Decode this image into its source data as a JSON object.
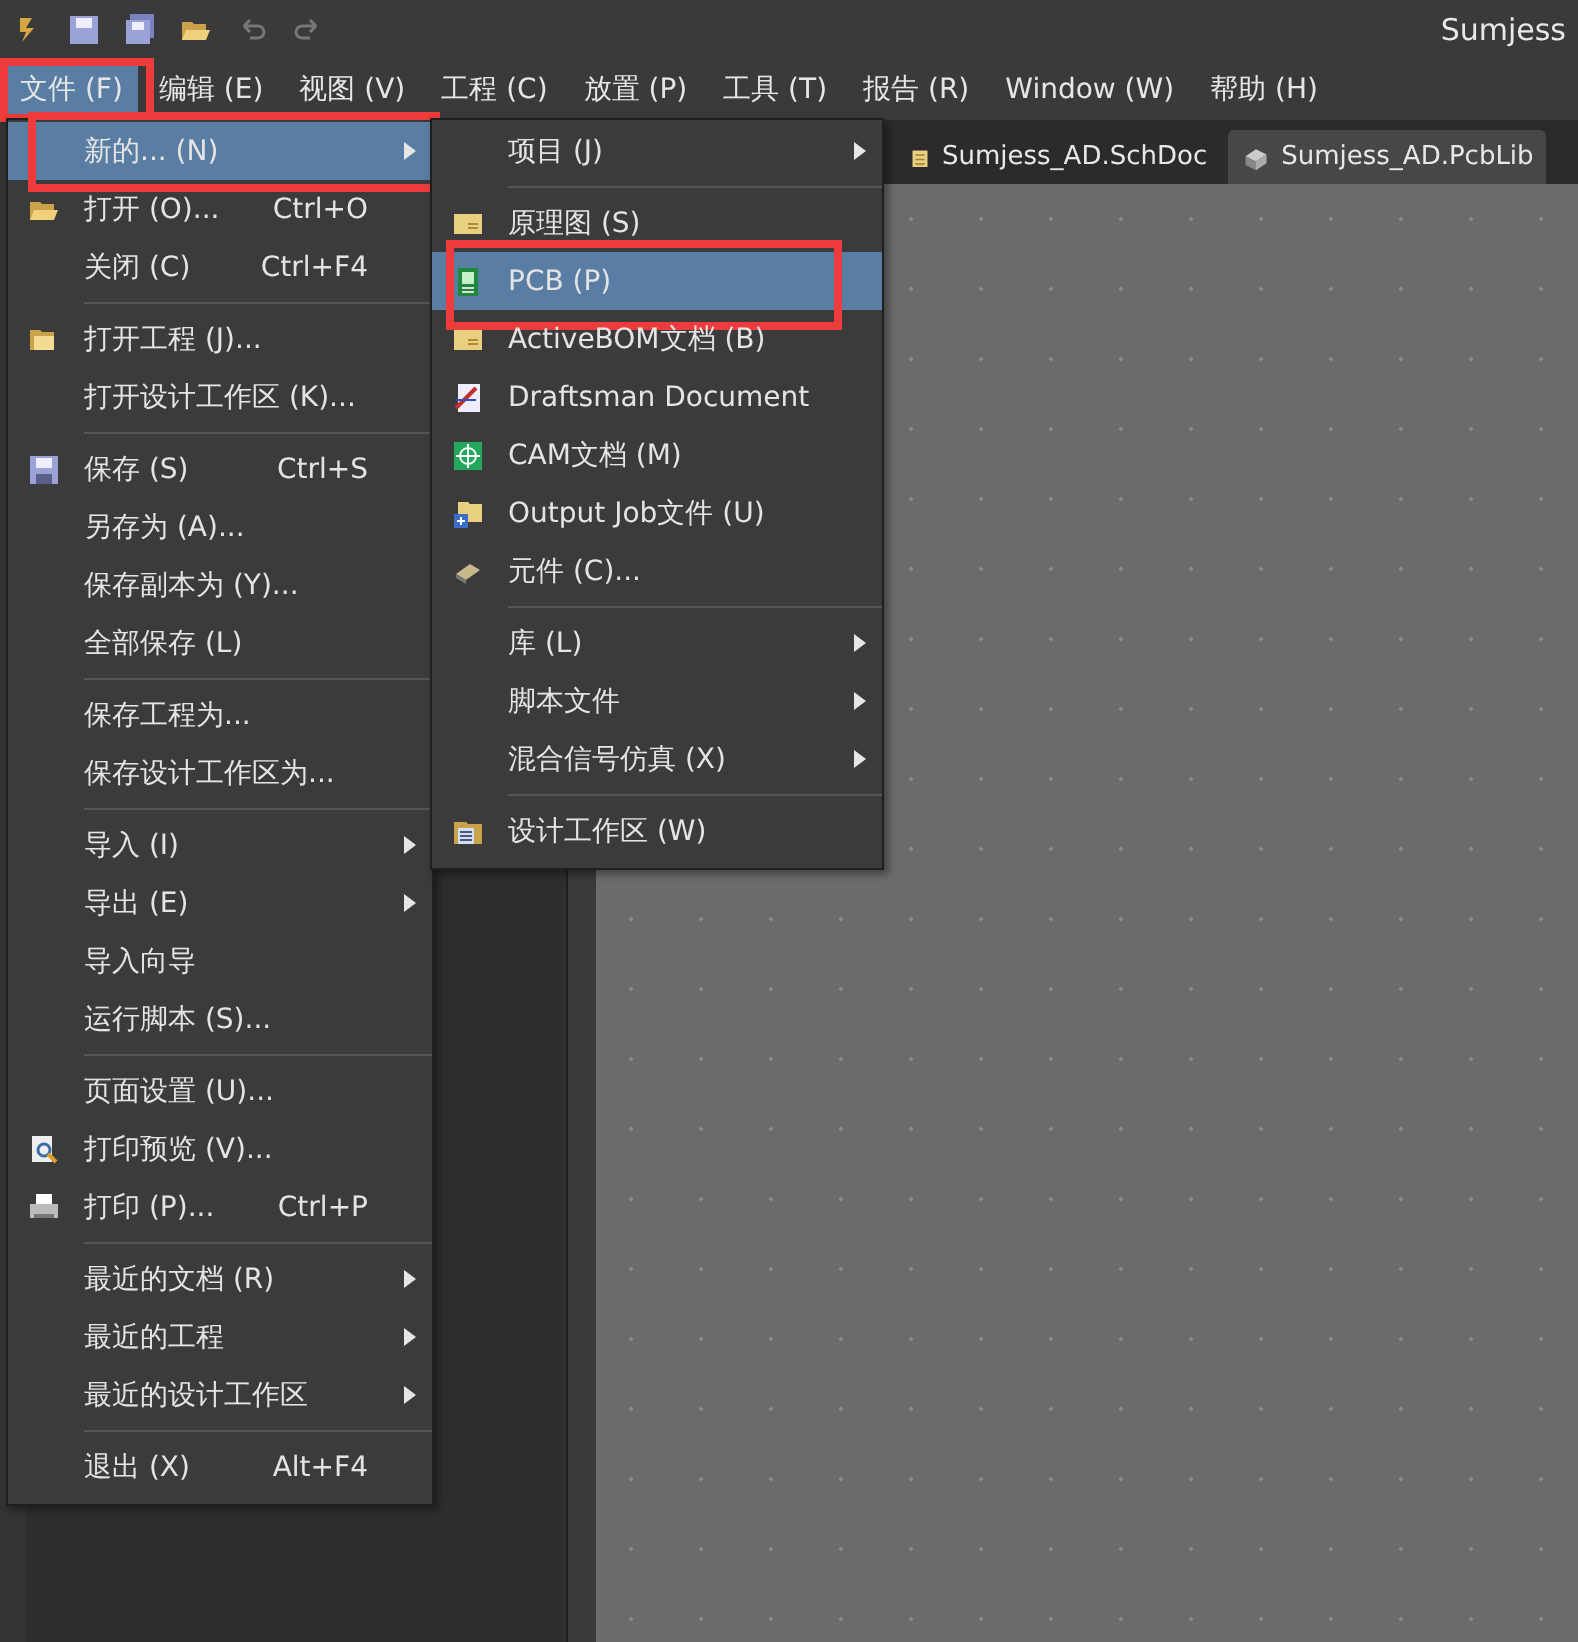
{
  "window": {
    "title": "Sumjess"
  },
  "menu_bar": [
    {
      "label": "文件 (F)",
      "selected": true,
      "highlighted": true
    },
    {
      "label": "编辑 (E)",
      "selected": false,
      "highlighted": false
    },
    {
      "label": "视图 (V)",
      "selected": false,
      "highlighted": false
    },
    {
      "label": "工程 (C)",
      "selected": false,
      "highlighted": false
    },
    {
      "label": "放置 (P)",
      "selected": false,
      "highlighted": false
    },
    {
      "label": "工具 (T)",
      "selected": false,
      "highlighted": false
    },
    {
      "label": "报告 (R)",
      "selected": false,
      "highlighted": false
    },
    {
      "label": "Window (W)",
      "selected": false,
      "highlighted": false
    },
    {
      "label": "帮助 (H)",
      "selected": false,
      "highlighted": false
    }
  ],
  "tabs": [
    {
      "label": "Sumjess_AD.SchDoc",
      "selected": false
    },
    {
      "label": "Sumjess_AD.PcbLib",
      "selected": true
    }
  ],
  "file_menu": [
    {
      "kind": "item",
      "label": "新的... (N)",
      "submenu": true,
      "selected": true,
      "highlighted": true
    },
    {
      "kind": "item",
      "label": "打开 (O)...",
      "shortcut": "Ctrl+O",
      "submenu": false,
      "selected": false,
      "highlighted": false
    },
    {
      "kind": "item",
      "label": "关闭 (C)",
      "shortcut": "Ctrl+F4",
      "submenu": false,
      "selected": false,
      "highlighted": false
    },
    {
      "kind": "separator"
    },
    {
      "kind": "item",
      "label": "打开工程 (J)...",
      "submenu": false,
      "selected": false,
      "highlighted": false
    },
    {
      "kind": "item",
      "label": "打开设计工作区 (K)...",
      "submenu": false,
      "selected": false,
      "highlighted": false
    },
    {
      "kind": "separator"
    },
    {
      "kind": "item",
      "label": "保存 (S)",
      "shortcut": "Ctrl+S",
      "submenu": false,
      "selected": false,
      "highlighted": false
    },
    {
      "kind": "item",
      "label": "另存为 (A)...",
      "submenu": false,
      "selected": false,
      "highlighted": false
    },
    {
      "kind": "item",
      "label": "保存副本为 (Y)...",
      "submenu": false,
      "selected": false,
      "highlighted": false
    },
    {
      "kind": "item",
      "label": "全部保存 (L)",
      "submenu": false,
      "selected": false,
      "highlighted": false
    },
    {
      "kind": "separator"
    },
    {
      "kind": "item",
      "label": "保存工程为...",
      "submenu": false,
      "selected": false,
      "highlighted": false
    },
    {
      "kind": "item",
      "label": "保存设计工作区为...",
      "submenu": false,
      "selected": false,
      "highlighted": false
    },
    {
      "kind": "separator"
    },
    {
      "kind": "item",
      "label": "导入 (I)",
      "submenu": true,
      "selected": false,
      "highlighted": false
    },
    {
      "kind": "item",
      "label": "导出 (E)",
      "submenu": true,
      "selected": false,
      "highlighted": false
    },
    {
      "kind": "item",
      "label": "导入向导",
      "submenu": false,
      "selected": false,
      "highlighted": false
    },
    {
      "kind": "item",
      "label": "运行脚本 (S)...",
      "submenu": false,
      "selected": false,
      "highlighted": false
    },
    {
      "kind": "separator"
    },
    {
      "kind": "item",
      "label": "页面设置 (U)...",
      "submenu": false,
      "selected": false,
      "highlighted": false
    },
    {
      "kind": "item",
      "label": "打印预览 (V)...",
      "submenu": false,
      "selected": false,
      "highlighted": false
    },
    {
      "kind": "item",
      "label": "打印 (P)...",
      "shortcut": "Ctrl+P",
      "submenu": false,
      "selected": false,
      "highlighted": false
    },
    {
      "kind": "separator"
    },
    {
      "kind": "item",
      "label": "最近的文档 (R)",
      "submenu": true,
      "selected": false,
      "highlighted": false
    },
    {
      "kind": "item",
      "label": "最近的工程",
      "submenu": true,
      "selected": false,
      "highlighted": false
    },
    {
      "kind": "item",
      "label": "最近的设计工作区",
      "submenu": true,
      "selected": false,
      "highlighted": false
    },
    {
      "kind": "separator"
    },
    {
      "kind": "item",
      "label": "退出 (X)",
      "shortcut": "Alt+F4",
      "submenu": false,
      "selected": false,
      "highlighted": false
    }
  ],
  "new_submenu": [
    {
      "kind": "item",
      "label": "项目 (J)",
      "submenu": true,
      "selected": false,
      "highlighted": false
    },
    {
      "kind": "separator"
    },
    {
      "kind": "item",
      "label": "原理图 (S)",
      "submenu": false,
      "selected": false,
      "highlighted": false
    },
    {
      "kind": "item",
      "label": "PCB (P)",
      "submenu": false,
      "selected": true,
      "highlighted": true
    },
    {
      "kind": "item",
      "label": "ActiveBOM文档 (B)",
      "submenu": false,
      "selected": false,
      "highlighted": false
    },
    {
      "kind": "item",
      "label": "Draftsman Document",
      "submenu": false,
      "selected": false,
      "highlighted": false
    },
    {
      "kind": "item",
      "label": "CAM文档 (M)",
      "submenu": false,
      "selected": false,
      "highlighted": false
    },
    {
      "kind": "item",
      "label": "Output Job文件 (U)",
      "submenu": false,
      "selected": false,
      "highlighted": false
    },
    {
      "kind": "item",
      "label": "元件 (C)...",
      "submenu": false,
      "selected": false,
      "highlighted": false
    },
    {
      "kind": "separator"
    },
    {
      "kind": "item",
      "label": "库 (L)",
      "submenu": true,
      "selected": false,
      "highlighted": false
    },
    {
      "kind": "item",
      "label": "脚本文件",
      "submenu": true,
      "selected": false,
      "highlighted": false
    },
    {
      "kind": "item",
      "label": "混合信号仿真 (X)",
      "submenu": true,
      "selected": false,
      "highlighted": false
    },
    {
      "kind": "separator"
    },
    {
      "kind": "item",
      "label": "设计工作区 (W)",
      "submenu": false,
      "selected": false,
      "highlighted": false
    }
  ]
}
